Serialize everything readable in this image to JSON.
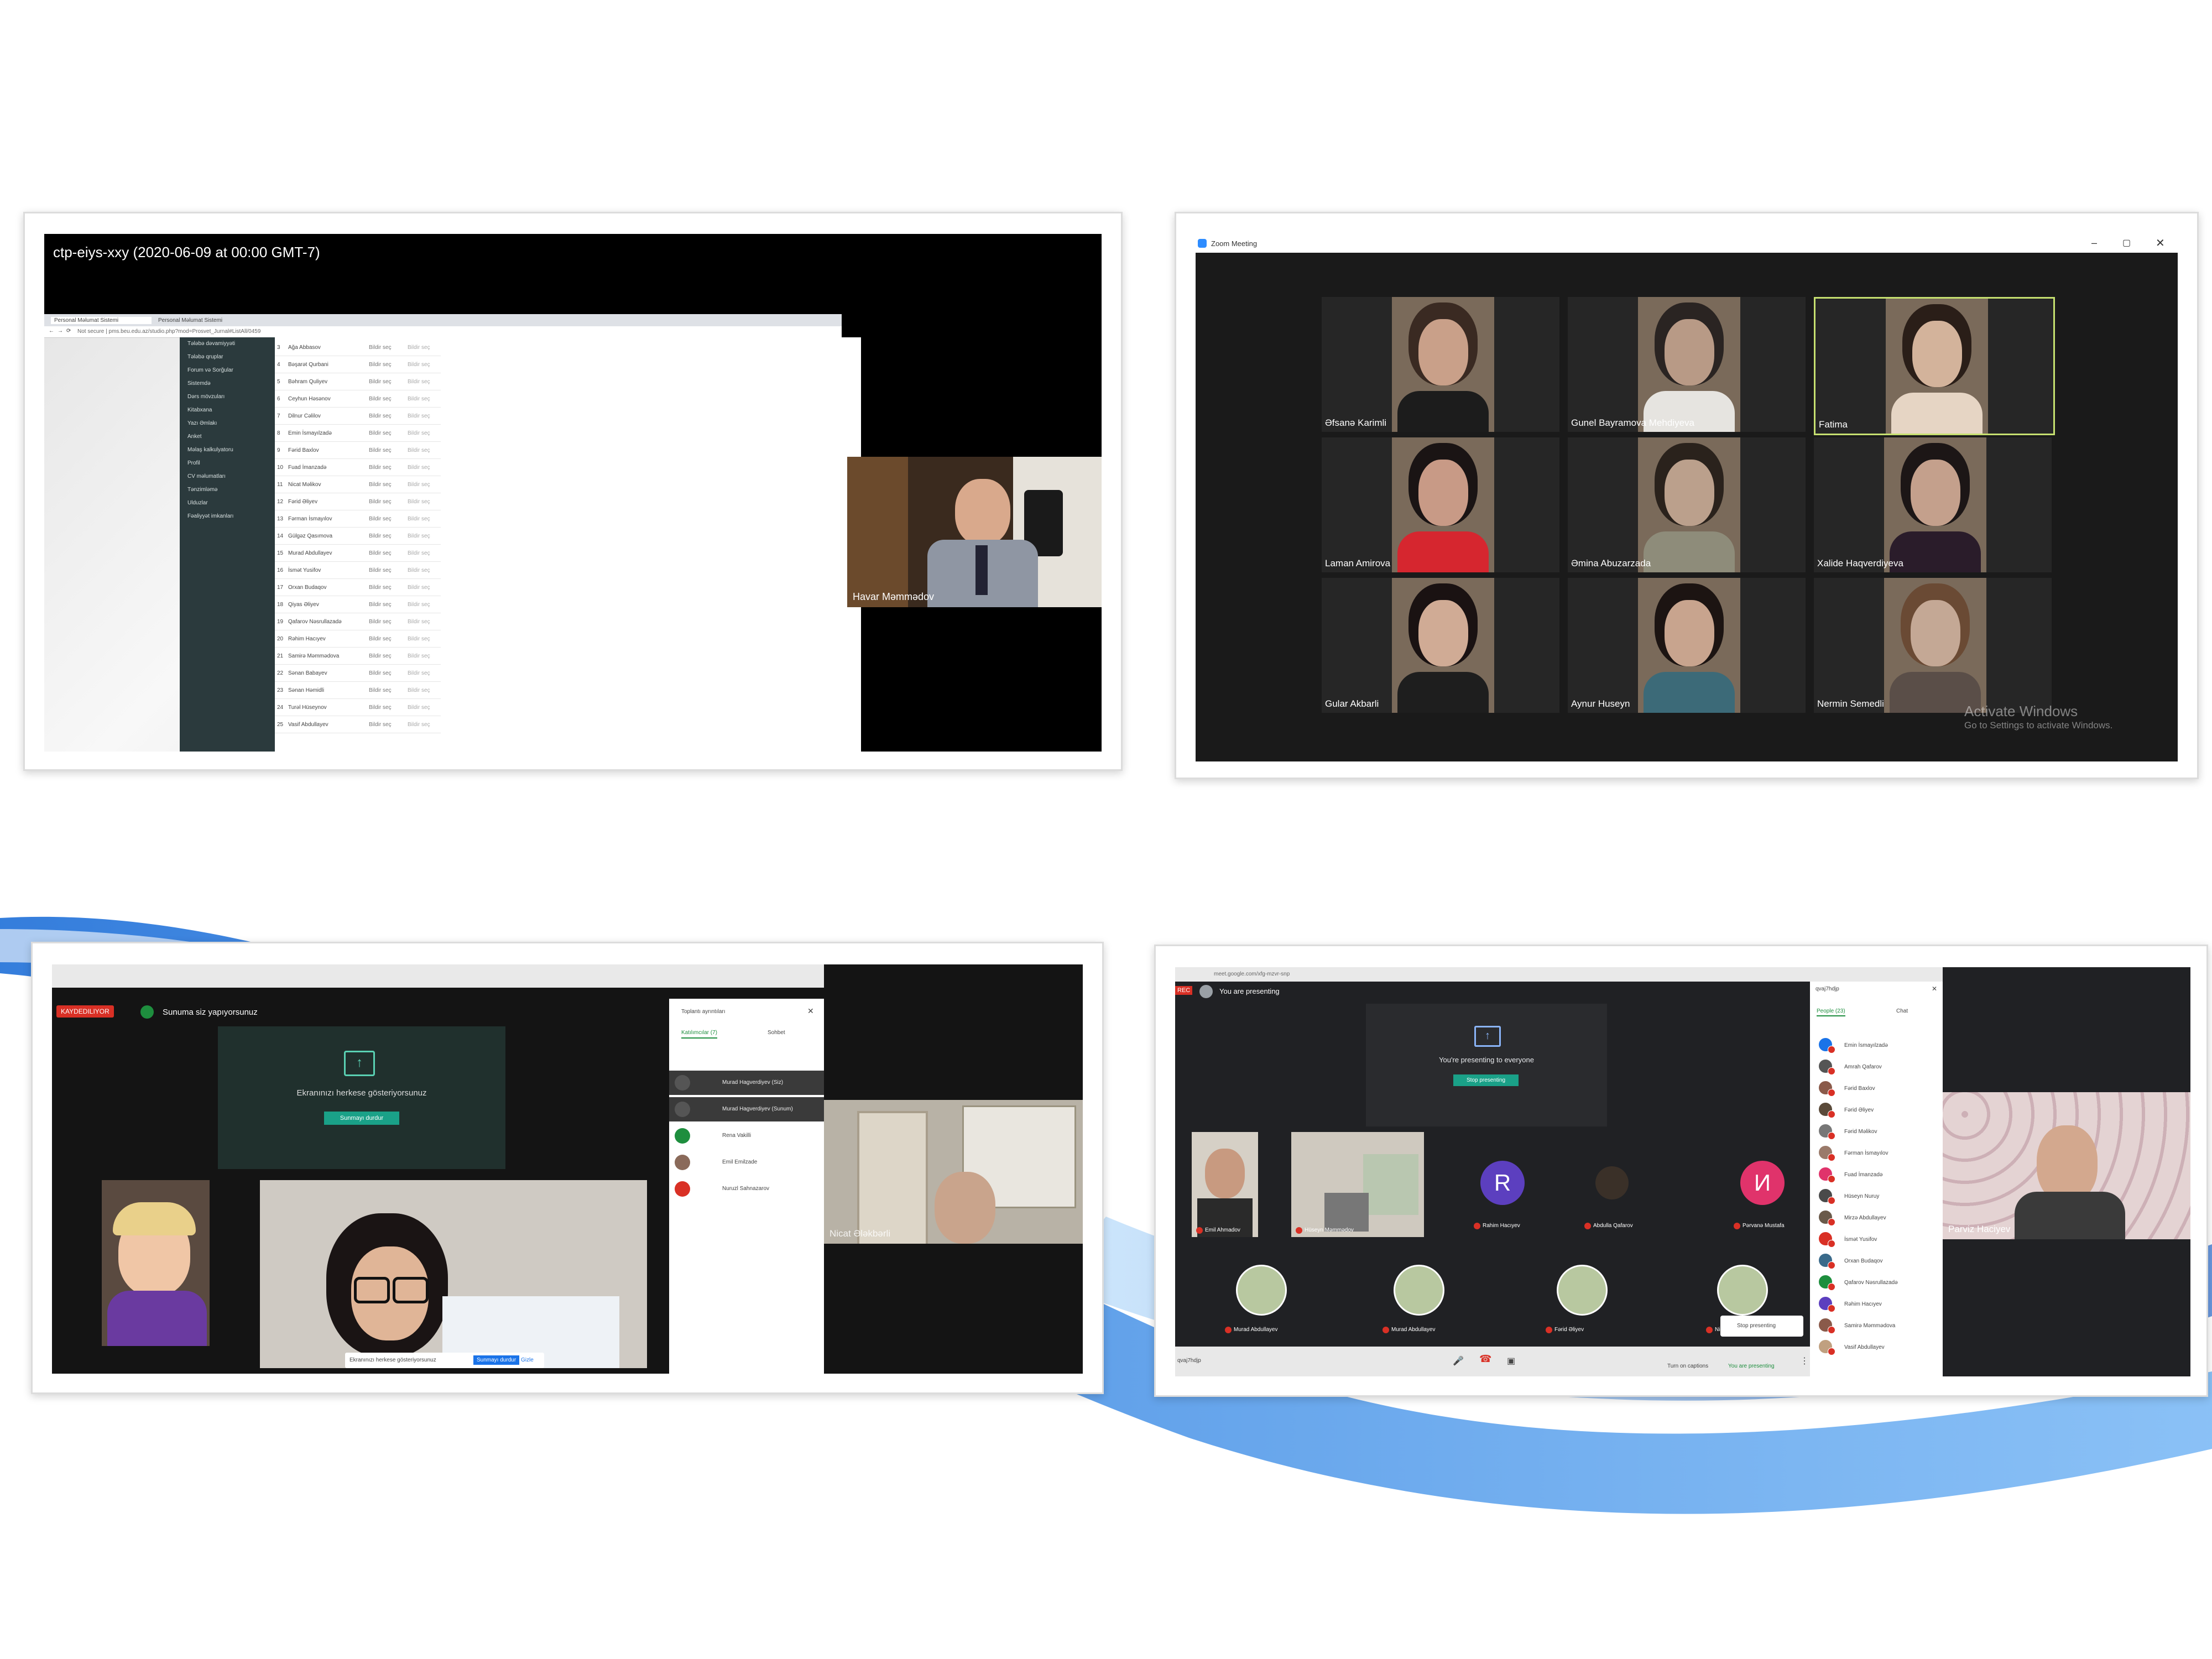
{
  "panel1": {
    "title": "ctp-eiys-xxy (2020-06-09 at 00:00 GMT-7)",
    "tab1": "Personal Məlumat Sistemi",
    "tab2": "Personal Məlumat Sistemi",
    "url": "Not secure | pms.beu.edu.az/studio.php?mod=Prosvet_Jurnal#ListAll/0459",
    "menu": [
      "Tələbə dəvamiyyəti",
      "Tələbə qruplar",
      "Forum və Sorğular",
      "Sistemdə",
      "Dərs mövzuları",
      "Kitabxana",
      "Yazı Əmlakı",
      "Anket",
      "Məlaş kalkulyatoru",
      "Profil",
      "CV məlumatları",
      "Tənzimləmə",
      "Ulduzlar",
      "Fəaliyyət imkanları"
    ],
    "students": [
      "Ağa Abbasov",
      "Bəşarət Qurbani",
      "Bəhram Quliyev",
      "Ceyhun Həsənov",
      "Dilnur Cəlilov",
      "Emin İsmayılzadə",
      "Fərid Baxlov",
      "Fuad İmanzadə",
      "Nicat Məlikov",
      "Fərid Əliyev",
      "Fərman İsmayılov",
      "Gülgəz Qasımova",
      "Murad Abdullayev",
      "İsmət Yusifov",
      "Orxan Budaqov",
      "Qiyas Əliyev",
      "Qafarov Nəsrullazadə",
      "Rəhim Hacıyev",
      "Samirə Məmmədova",
      "Sənan Babayev",
      "Sənan Həmidli",
      "Turəl Hüseynov",
      "Vasif Abdullayev"
    ],
    "cell_label": "Bildir seç",
    "speaker_name": "Havar Məmmədov"
  },
  "panel2": {
    "window_title": "Zoom Meeting",
    "participants": [
      "Əfsanə Karimli",
      "Gunel Bayramova Mehdiyeva",
      "Fatima",
      "Laman Amirova",
      "Əmina Abuzarzada",
      "Xalide Haqverdiyeva",
      "Gular Akbarli",
      "Aynur Huseyn",
      "Nermin Semedli"
    ],
    "watermark_title": "Activate Windows",
    "watermark_sub": "Go to Settings to activate Windows.",
    "highlight_color": "#c6e070"
  },
  "panel3": {
    "rec_label": "KAYDEDILIYOR",
    "header_text": "Sunuma siz yapıyorsunuz",
    "present_text": "Ekranınızı herkese gösteriyorsunuz",
    "stop_button": "Sunmayı durdur",
    "side_title": "Toplantı ayrıntıları",
    "side_tab1": "Katılımcılar (7)",
    "side_tab2": "Sohbet",
    "side_people": [
      "Murad Hagverdiyev (Siz)",
      "Murad Hagverdiyev (Sunum)",
      "Rena Vakilli",
      "Emil Emilzade",
      "Nuruzl Sahnazarov"
    ],
    "bottom_notice": "Ekranınızı herkese gösteriyorsunuz",
    "bottom_btn1": "Sunmayı durdur",
    "bottom_btn2": "Gizle",
    "speaker_name": "Nicat Ələkbərli"
  },
  "panel4": {
    "url": "meet.google.com/xfg-mzvr-snp",
    "rec_label": "REC",
    "header_text": "You are presenting",
    "present_text": "You're presenting to everyone",
    "stop_button": "Stop presenting",
    "tiles": [
      "Emil Ahmadov",
      "Hüseyn Məmmədov",
      "Rahim Hacıyev",
      "Abdulla Qafarov",
      "Pərvanə Mustafa",
      "Murad Abdullayev",
      "Murad Abdullayev",
      "Fərid Əliyev",
      "Nicat Şahbazov"
    ],
    "avatar_letters": [
      "R",
      "И"
    ],
    "avatar_colors": [
      "#5c3fbf",
      "#e0336b"
    ],
    "side_search": "qvaj7hdjp",
    "side_tab1": "People (23)",
    "side_tab2": "Chat",
    "side_people": [
      "Emin İsmayılzadə",
      "Amrah Qafarov",
      "Fərid Baxlov",
      "Fərid Əliyev",
      "Fərid Məlikov",
      "Fərman İsmayılov",
      "Fuad İmanzadə",
      "Hüseyn Nuruy",
      "Mirzə Abdullayev",
      "İsmət Yusifov",
      "Orxan Budaqov",
      "Qafarov Nəsrullazadə",
      "Rəhim Hacıyev",
      "Samirə Məmmədova",
      "Vasif Abdullayev"
    ],
    "bottom_meeting_code": "qvaj7hdjp",
    "bottom_captions": "Turn on captions",
    "bottom_presenting": "You are presenting",
    "stop_small": "Stop presenting",
    "speaker_name": "Parviz Haciyev"
  }
}
